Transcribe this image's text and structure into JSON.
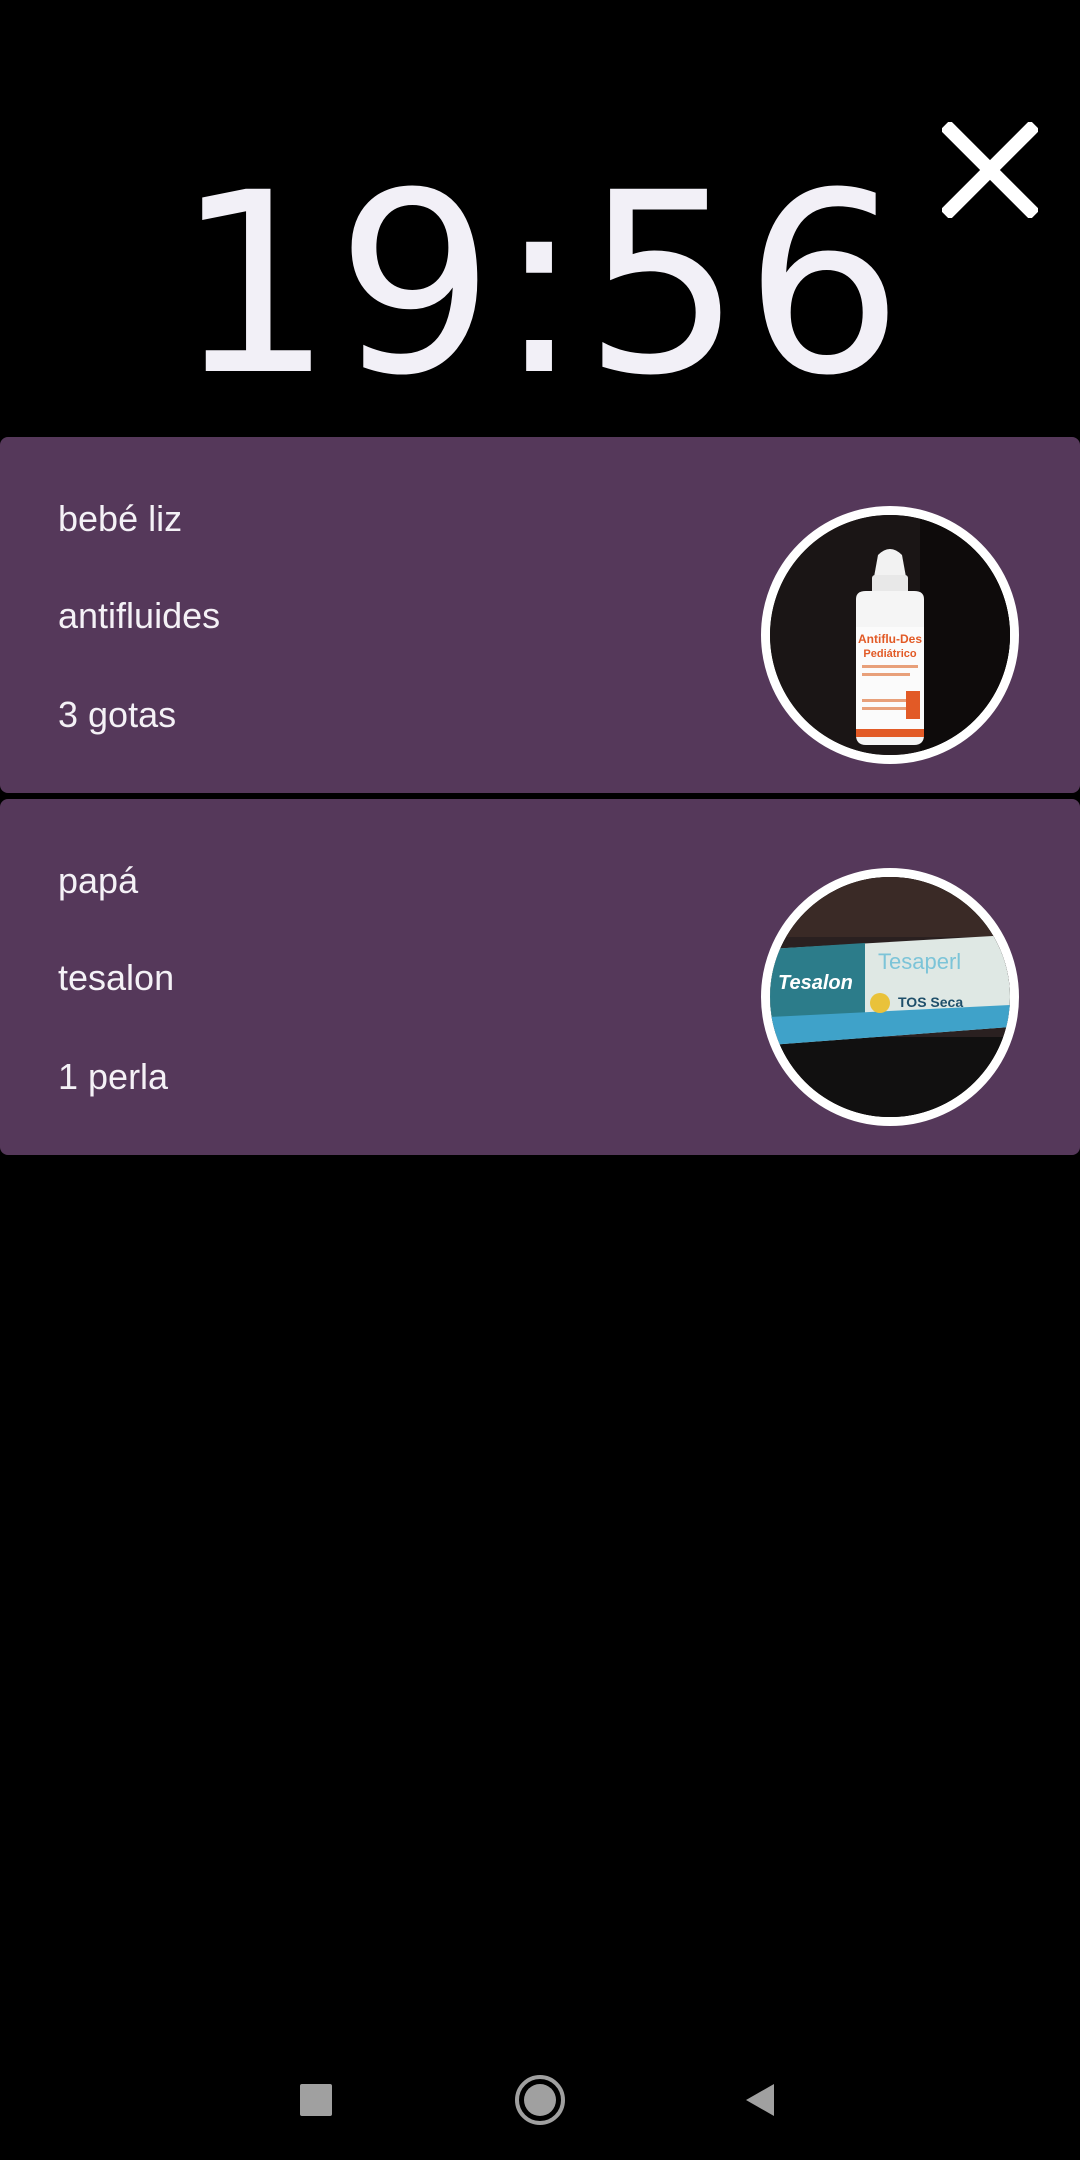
{
  "clock": {
    "time": "19:56"
  },
  "close": {
    "icon": "close-icon"
  },
  "reminders": [
    {
      "person": "bebé liz",
      "medicine": "antifluides",
      "dose": "3 gotas",
      "image": "medicine-bottle-photo",
      "image_text": [
        "Antiflu-Des",
        "Pediátrico"
      ]
    },
    {
      "person": "papá",
      "medicine": "tesalon",
      "dose": "1 perla",
      "image": "medicine-box-photo",
      "image_text": [
        "Tesalon",
        "Tesaperl",
        "TOS Seca"
      ]
    }
  ],
  "nav": {
    "recent": "recent-apps-icon",
    "home": "home-icon",
    "back": "back-icon"
  },
  "colors": {
    "background": "#000000",
    "card": "#55385a",
    "text": "#f4f1f6"
  }
}
